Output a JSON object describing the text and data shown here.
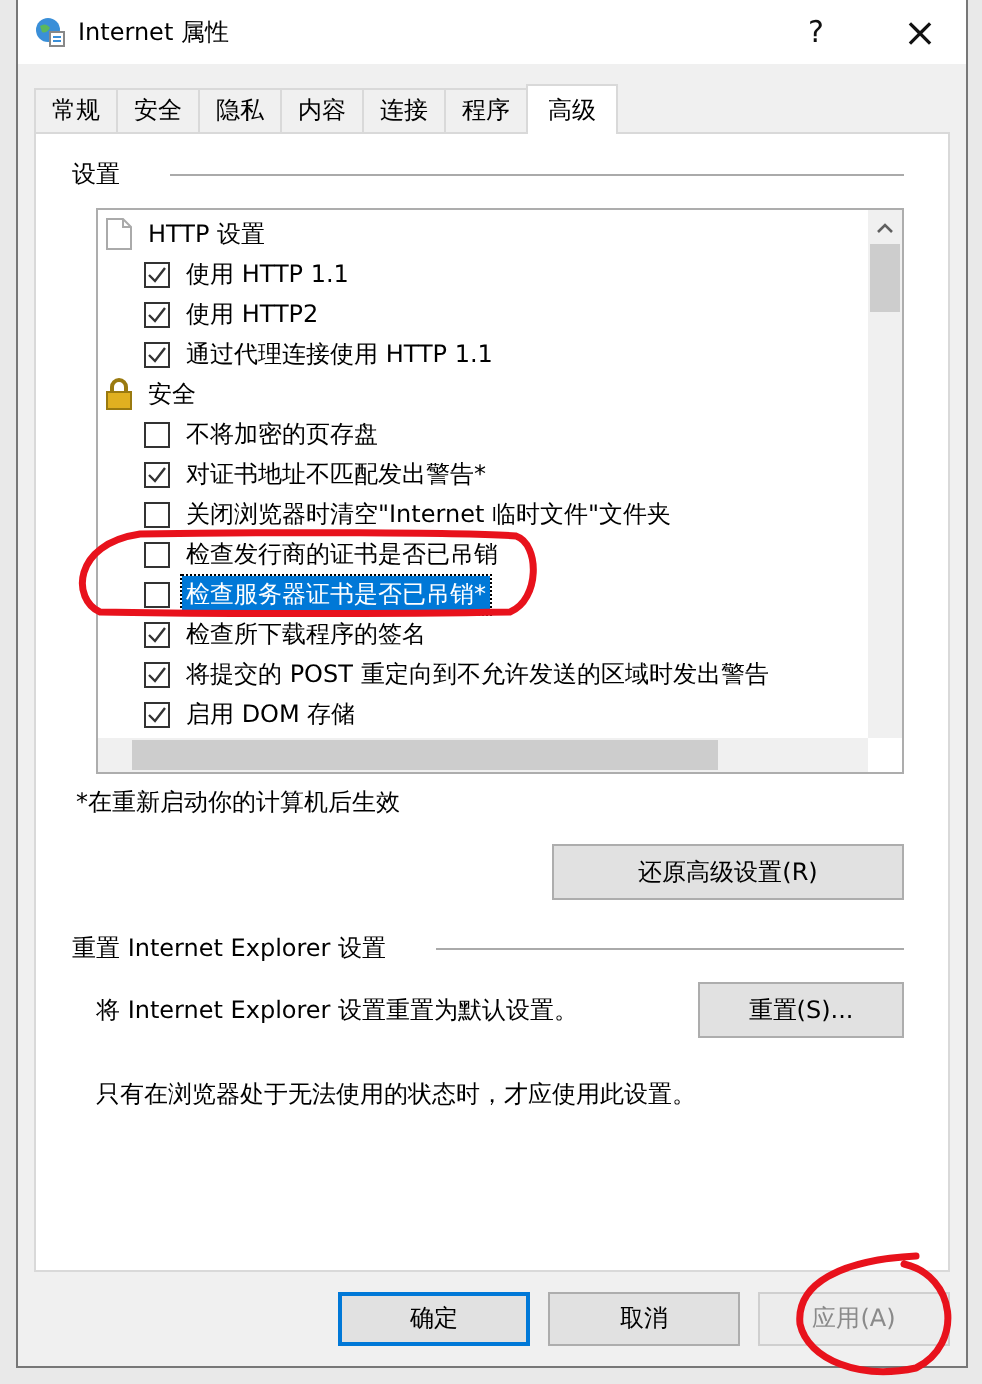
{
  "window": {
    "title": "Internet 属性",
    "help": "?",
    "close": "×"
  },
  "tabs": [
    {
      "label": "常规",
      "selected": false
    },
    {
      "label": "安全",
      "selected": false
    },
    {
      "label": "隐私",
      "selected": false
    },
    {
      "label": "内容",
      "selected": false
    },
    {
      "label": "连接",
      "selected": false
    },
    {
      "label": "程序",
      "selected": false
    },
    {
      "label": "高级",
      "selected": true
    }
  ],
  "settings": {
    "heading": "设置",
    "items": [
      {
        "kind": "pagegroup",
        "label": "HTTP 设置"
      },
      {
        "kind": "checkbox",
        "label": "使用 HTTP 1.1",
        "checked": true,
        "selected": false
      },
      {
        "kind": "checkbox",
        "label": "使用 HTTP2",
        "checked": true,
        "selected": false
      },
      {
        "kind": "checkbox",
        "label": "通过代理连接使用 HTTP 1.1",
        "checked": true,
        "selected": false
      },
      {
        "kind": "lockgroup",
        "label": "安全"
      },
      {
        "kind": "checkbox",
        "label": "不将加密的页存盘",
        "checked": false,
        "selected": false
      },
      {
        "kind": "checkbox",
        "label": "对证书地址不匹配发出警告*",
        "checked": true,
        "selected": false
      },
      {
        "kind": "checkbox",
        "label": "关闭浏览器时清空\"Internet 临时文件\"文件夹",
        "checked": false,
        "selected": false
      },
      {
        "kind": "checkbox",
        "label": "检查发行商的证书是否已吊销",
        "checked": false,
        "selected": false
      },
      {
        "kind": "checkbox",
        "label": "检查服务器证书是否已吊销*",
        "checked": false,
        "selected": true
      },
      {
        "kind": "checkbox",
        "label": "检查所下载程序的签名",
        "checked": true,
        "selected": false
      },
      {
        "kind": "checkbox",
        "label": "将提交的 POST 重定向到不允许发送的区域时发出警告",
        "checked": true,
        "selected": false
      },
      {
        "kind": "checkbox",
        "label": "启用 DOM 存储",
        "checked": true,
        "selected": false
      }
    ],
    "note": "*在重新启动你的计算机后生效",
    "restore_button": "还原高级设置(R)"
  },
  "reset": {
    "heading": "重置 Internet Explorer 设置",
    "description": "将 Internet Explorer 设置重置为默认设置。",
    "button": "重置(S)...",
    "warning": "只有在浏览器处于无法使用的状态时，才应使用此设置。"
  },
  "buttons": [
    {
      "label": "确定",
      "default": true,
      "disabled": false
    },
    {
      "label": "取消",
      "default": false,
      "disabled": false
    },
    {
      "label": "应用(A)",
      "default": false,
      "disabled": true
    }
  ],
  "annotations": [
    {
      "kind": "circle"
    },
    {
      "kind": "circle"
    }
  ]
}
